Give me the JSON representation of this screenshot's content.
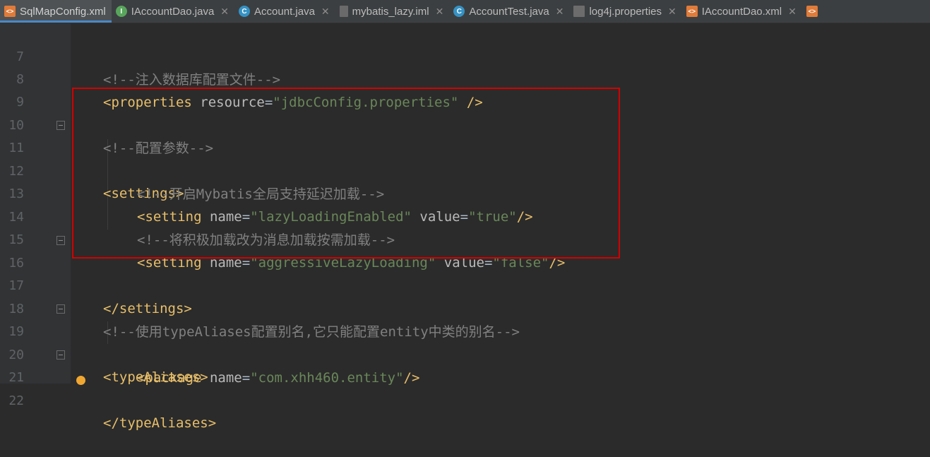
{
  "tabs": [
    {
      "label": "SqlMapConfig.xml",
      "icon": "xml-file-icon",
      "active": true
    },
    {
      "label": "IAccountDao.java",
      "icon": "interface-icon",
      "active": false
    },
    {
      "label": "Account.java",
      "icon": "class-icon",
      "active": false
    },
    {
      "label": "mybatis_lazy.iml",
      "icon": "module-file-icon",
      "active": false
    },
    {
      "label": "AccountTest.java",
      "icon": "test-class-icon",
      "active": false
    },
    {
      "label": "log4j.properties",
      "icon": "properties-file-icon",
      "active": false
    },
    {
      "label": "IAccountDao.xml",
      "icon": "xml-file-icon",
      "active": false
    }
  ],
  "editor": {
    "lines": [
      {
        "n": "7",
        "comment": "<!--注入数据库配置文件-->"
      },
      {
        "n": "8",
        "open": "<properties",
        "attr1": "resource",
        "val1": "\"jdbcConfig.properties\"",
        "close": " />"
      },
      {
        "n": "9"
      },
      {
        "n": "10",
        "comment": "<!--配置参数-->"
      },
      {
        "n": "11",
        "tag": "<settings>"
      },
      {
        "n": "12",
        "comment": "<!--开启Mybatis全局支持延迟加载-->"
      },
      {
        "n": "13",
        "open": "<setting",
        "attr1": "name",
        "val1": "\"lazyLoadingEnabled\"",
        "attr2": "value",
        "val2": "\"true\"",
        "close": "/>"
      },
      {
        "n": "14",
        "comment": "<!--将积极加载改为消息加载按需加载-->"
      },
      {
        "n": "15",
        "open": "<setting",
        "attr1": "name",
        "val1": "\"aggressiveLazyLoading\"",
        "attr2": "value",
        "val2": "\"false\"",
        "close": "/>"
      },
      {
        "n": "16",
        "tag": "</settings>"
      },
      {
        "n": "17"
      },
      {
        "n": "18",
        "comment": "<!--使用typeAliases配置别名,它只能配置entity中类的别名-->"
      },
      {
        "n": "19",
        "tag": "<typeAliases>"
      },
      {
        "n": "20",
        "open": "<package",
        "attr1": "name",
        "val1": "\"com.xhh460.entity\"",
        "close": "/>"
      },
      {
        "n": "21",
        "tag": "</typeAliases>"
      },
      {
        "n": "22"
      }
    ]
  },
  "colors": {
    "background": "#2b2b2b",
    "tag": "#e8bf6a",
    "attribute": "#bababa",
    "string": "#6a8759",
    "comment": "#808080",
    "annotation_box": "#d40000"
  }
}
